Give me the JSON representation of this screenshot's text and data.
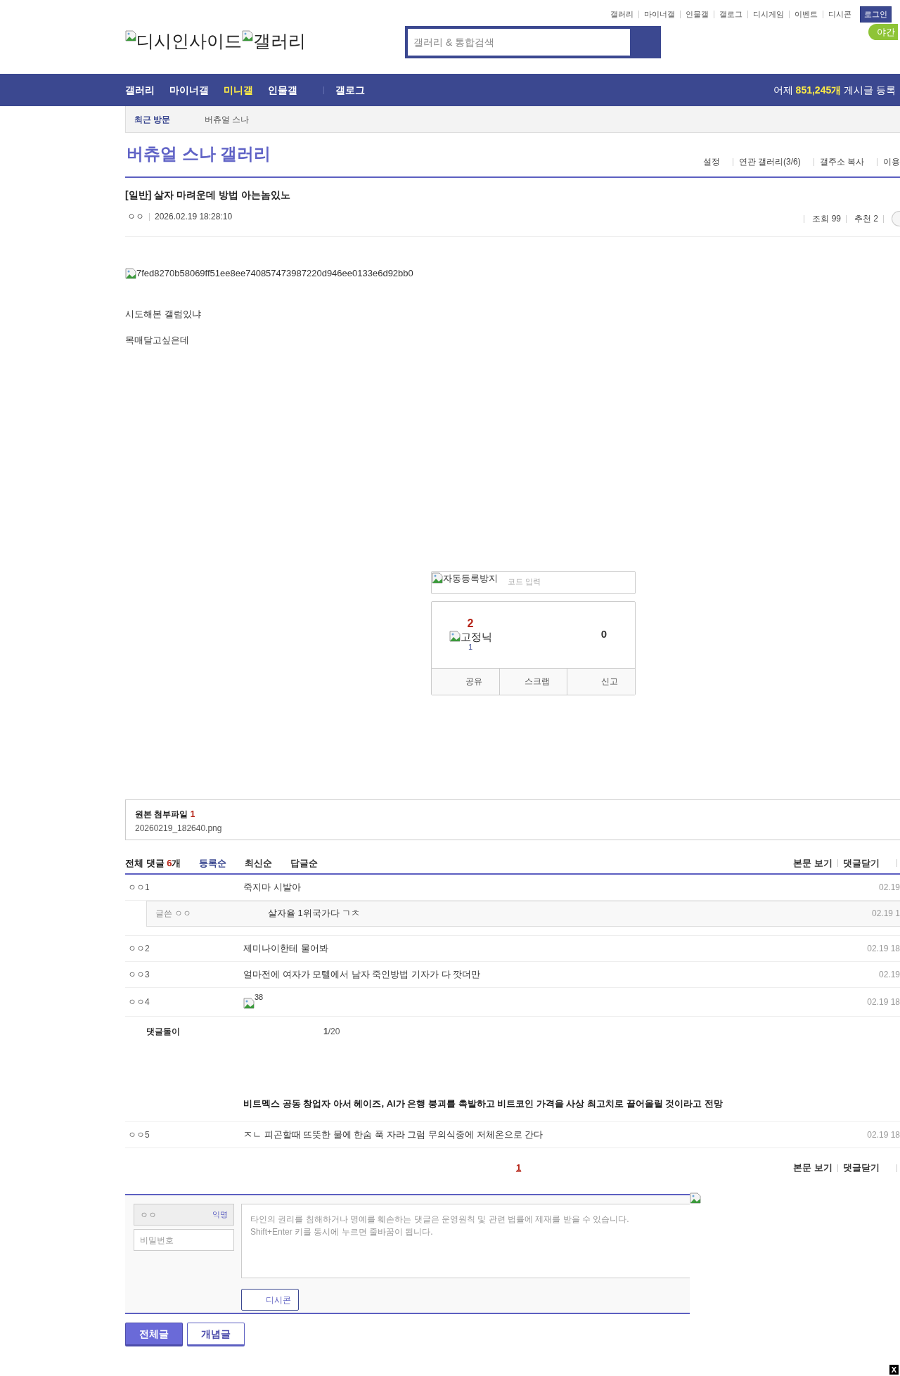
{
  "util_links": [
    "갤러리",
    "마이너갤",
    "인물갤",
    "갤로그",
    "디시게임",
    "이벤트",
    "디시콘"
  ],
  "login": "로그인",
  "logo": {
    "site": "디시인사이드",
    "section": "갤러리"
  },
  "search": {
    "placeholder": "갤러리 & 통합검색"
  },
  "night_mode": "야간",
  "nav": [
    {
      "label": "갤러리",
      "selected": false
    },
    {
      "label": "마이너갤",
      "selected": false
    },
    {
      "label": "미니갤",
      "selected": true
    },
    {
      "label": "인물갤",
      "selected": false
    },
    {
      "label": "갤로그",
      "selected": false
    }
  ],
  "nav_stats": {
    "prefix": "어제",
    "count": "851,245개",
    "suffix": "게시글 등록"
  },
  "recent": {
    "label": "최근 방문",
    "items": [
      "버츄얼 스나"
    ]
  },
  "gallery": {
    "title": "버츄얼 스나 갤러리",
    "links": [
      "설정",
      "연관 갤러리(3/6)",
      "갤주소 복사",
      "이용"
    ]
  },
  "post": {
    "title": "[일반] 살자 마려운데 방법 아는놈있노",
    "author": "ㅇㅇ",
    "date": "2026.02.19 18:28:10",
    "views": "조회 99",
    "recommend": "추천 2",
    "image_alt": "7fed8270b58069ff51ee8ee740857473987220d946ee0133e6d92bb0",
    "lines": [
      "시도해본 갤럼있냐",
      "목매달고싶은데"
    ]
  },
  "captcha": {
    "alt": "자동등록방지",
    "placeholder": "코드 입력"
  },
  "votes": {
    "up": "2",
    "fixed_label": "고정닉",
    "fixed": "1",
    "down": "0",
    "buttons": [
      "공유",
      "스크랩",
      "신고"
    ]
  },
  "attachment": {
    "label": "원본 첨부파일",
    "count": "1",
    "file": "20260219_182640.png"
  },
  "comments_header": {
    "label": "전체 댓글",
    "count": "6",
    "unit": "개",
    "sorts": [
      {
        "label": "등록순",
        "selected": true
      },
      {
        "label": "최신순",
        "selected": false
      },
      {
        "label": "답글순",
        "selected": false
      }
    ],
    "links": [
      "본문 보기",
      "댓글닫기"
    ]
  },
  "comments": [
    {
      "kind": "comment",
      "author": "ㅇㅇ1",
      "text": "죽지마 시발아",
      "date": "02.19"
    },
    {
      "kind": "reply",
      "author": "글쓴 ㅇㅇ",
      "text": "살자율 1위국가다 ㄱㅊ",
      "date": "02.19 1"
    },
    {
      "kind": "comment",
      "author": "ㅇㅇ2",
      "text": "제미나이한테 물어봐",
      "date": "02.19 18"
    },
    {
      "kind": "comment",
      "author": "ㅇㅇ3",
      "text": "얼마전에 여자가 모텔에서 남자 죽인방법 기자가 다 깟더만",
      "date": "02.19"
    },
    {
      "kind": "image",
      "author": "ㅇㅇ4",
      "text": "38",
      "date": "02.19 18"
    },
    {
      "kind": "bot",
      "author": "댓글돌이",
      "text": "**1**/20",
      "headline": "비트멕스 공동 창업자 아서 헤이즈, AI가 은행 붕괴를 촉발하고 비트코인 가격을 사상 최고치로 끌어올릴 것이라고 전망"
    },
    {
      "kind": "comment",
      "author": "ㅇㅇ5",
      "text": "ㅈㄴ 피곤할때 뜨뜻한 물에 한숨 푹 자라 그럼 무의식중에 저체온으로 간다",
      "date": "02.19 18"
    }
  ],
  "pagination": [
    {
      "label": "1",
      "selected": true
    }
  ],
  "footer_links": [
    "본문 보기",
    "댓글닫기"
  ],
  "form": {
    "name": "ㅇㅇ",
    "anon": "익명",
    "password_placeholder": "비밀번호",
    "textarea_placeholder": "타인의 권리를 침해하거나 명예를 훼손하는 댓글은 운영원칙 및 관련 법률에 제재를 받을 수 있습니다.\nShift+Enter 키를 동시에 누르면 줄바꿈이 됩니다.",
    "dccon": "디시콘"
  },
  "bottom_buttons": [
    {
      "label": "전체글",
      "selected": true
    },
    {
      "label": "개념글",
      "selected": false
    }
  ],
  "close_mark": "X"
}
